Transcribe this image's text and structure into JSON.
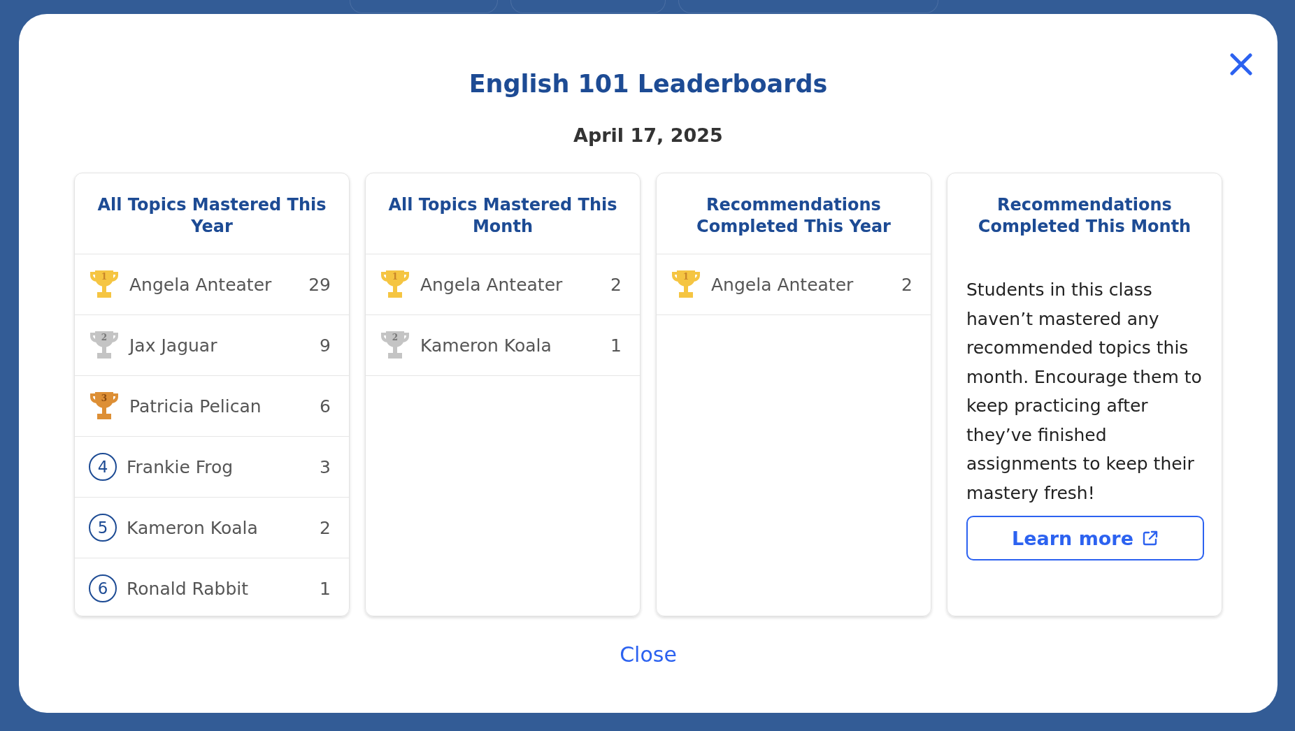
{
  "dialog": {
    "title": "English 101 Leaderboards",
    "date": "April 17, 2025",
    "close_label": "Close"
  },
  "boards": [
    {
      "title": "All Topics Mastered This Year",
      "kind": "list",
      "rows": [
        {
          "rank": "1",
          "kind": "trophy",
          "name": "Angela Anteater",
          "count": "29"
        },
        {
          "rank": "2",
          "kind": "trophy",
          "name": "Jax Jaguar",
          "count": "9"
        },
        {
          "rank": "3",
          "kind": "trophy",
          "name": "Patricia Pelican",
          "count": "6"
        },
        {
          "rank": "4",
          "kind": "circle",
          "name": "Frankie Frog",
          "count": "3"
        },
        {
          "rank": "5",
          "kind": "circle",
          "name": "Kameron Koala",
          "count": "2"
        },
        {
          "rank": "6",
          "kind": "circle",
          "name": "Ronald Rabbit",
          "count": "1"
        }
      ]
    },
    {
      "title": "All Topics Mastered This Month",
      "kind": "list",
      "rows": [
        {
          "rank": "1",
          "kind": "trophy",
          "name": "Angela Anteater",
          "count": "2"
        },
        {
          "rank": "2",
          "kind": "trophy",
          "name": "Kameron Koala",
          "count": "1"
        }
      ]
    },
    {
      "title": "Recommendations Completed This Year",
      "kind": "list",
      "rows": [
        {
          "rank": "1",
          "kind": "trophy",
          "name": "Angela Anteater",
          "count": "2"
        }
      ]
    },
    {
      "title": "Recommendations Completed This Month",
      "kind": "empty",
      "message": "Students in this class haven’t mastered any recommended topics this month. Encourage them to keep practicing after they’ve finished assignments to keep their mastery fresh!",
      "button": "Learn more"
    }
  ]
}
